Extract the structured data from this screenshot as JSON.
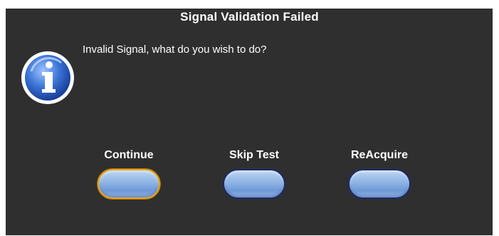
{
  "dialog": {
    "title": "Signal Validation Failed",
    "message": "Invalid Signal, what do you wish to do?",
    "icon": "info-icon"
  },
  "buttons": [
    {
      "label": "Continue",
      "focused": true
    },
    {
      "label": "Skip Test",
      "focused": false
    },
    {
      "label": "ReAcquire",
      "focused": false
    }
  ],
  "colors": {
    "background": "#2f2f2f",
    "text": "#ffffff",
    "button_fill": "#93b7e6",
    "button_border": "#1a2a6a",
    "focus_ring": "#e3a51d",
    "icon_blue": "#2f63c8"
  }
}
